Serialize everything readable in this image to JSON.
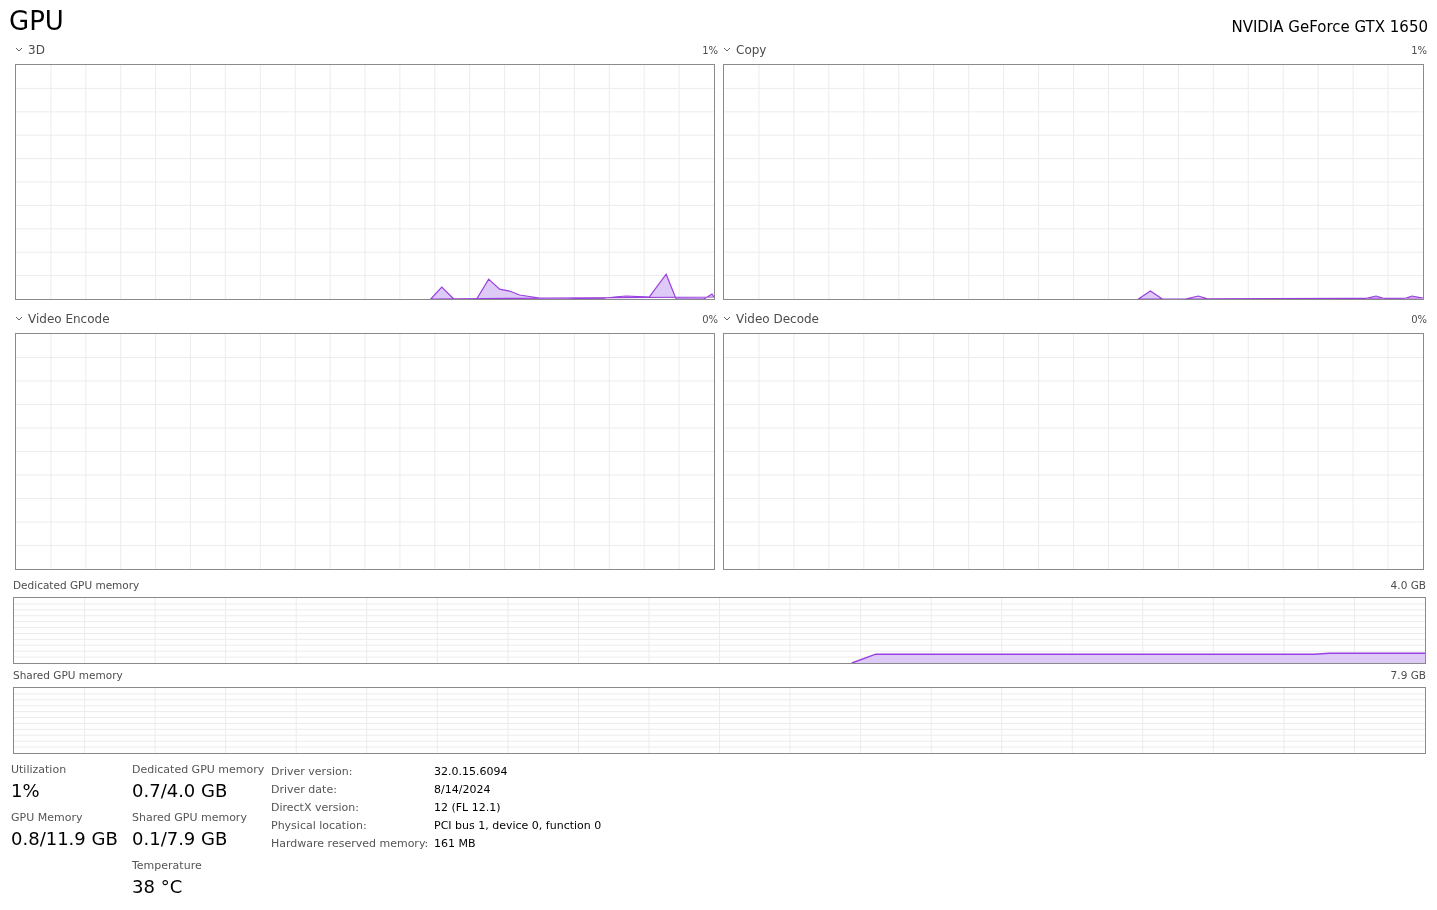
{
  "title": "GPU",
  "adapter": "NVIDIA GeForce GTX 1650",
  "engines": [
    {
      "name": "3D",
      "reading": "1%",
      "expanded": true
    },
    {
      "name": "Copy",
      "reading": "1%",
      "expanded": true
    },
    {
      "name": "Video Encode",
      "reading": "0%",
      "expanded": true
    },
    {
      "name": "Video Decode",
      "reading": "0%",
      "expanded": true
    }
  ],
  "memory_graphs": [
    {
      "label": "Dedicated GPU memory",
      "max": "4.0 GB"
    },
    {
      "label": "Shared GPU memory",
      "max": "7.9 GB"
    }
  ],
  "stats": [
    [
      {
        "label": "Utilization",
        "value": "1%"
      },
      {
        "label": "GPU Memory",
        "value": "0.8/11.9 GB"
      }
    ],
    [
      {
        "label": "Dedicated GPU memory",
        "value": "0.7/4.0 GB"
      },
      {
        "label": "Shared GPU memory",
        "value": "0.1/7.9 GB"
      },
      {
        "label": "Temperature",
        "value": "38 °C"
      }
    ]
  ],
  "details": [
    {
      "label": "Driver version:",
      "value": "32.0.15.6094"
    },
    {
      "label": "Driver date:",
      "value": "8/14/2024"
    },
    {
      "label": "DirectX version:",
      "value": "12 (FL 12.1)"
    },
    {
      "label": "Physical location:",
      "value": "PCI bus 1, device 0, function 0"
    },
    {
      "label": "Hardware reserved memory:",
      "value": "161 MB"
    }
  ]
}
